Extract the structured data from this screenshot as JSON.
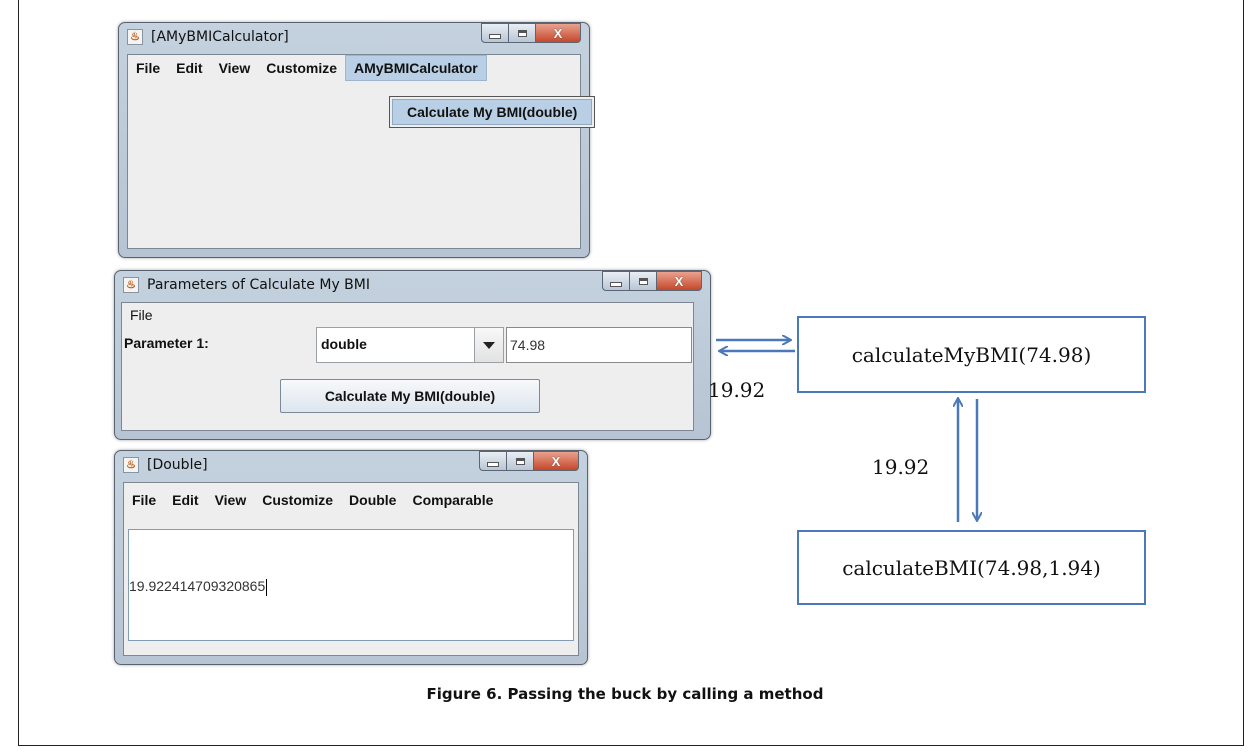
{
  "window_bmi": {
    "title": "[AMyBMICalculator]",
    "menu": [
      "File",
      "Edit",
      "View",
      "Customize",
      "AMyBMICalculator"
    ],
    "dropdown_item": "Calculate My BMI(double)"
  },
  "window_params": {
    "title": "Parameters of Calculate My BMI",
    "menu": [
      "File"
    ],
    "param_label": "Parameter 1:",
    "type_value": "double",
    "arg_value": "74.98",
    "button_label": "Calculate My BMI(double)"
  },
  "window_double": {
    "title": "[Double]",
    "menu": [
      "File",
      "Edit",
      "View",
      "Customize",
      "Double",
      "Comparable"
    ],
    "value": "19.922414709320865"
  },
  "diagram": {
    "call_my_bmi": "calculateMyBMI(74.98)",
    "call_bmi": "calculateBMI(74.98,1.94)",
    "return_top": "19.92",
    "return_mid": "19.92",
    "arrow_color": "#4a78b8"
  },
  "caption": "Figure 6. Passing the buck by calling a method"
}
